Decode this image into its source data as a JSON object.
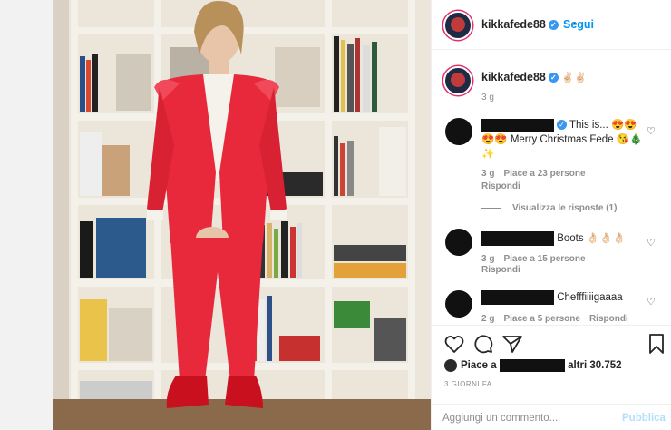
{
  "header": {
    "username": "kikkafede88",
    "follow_label": "Segui",
    "separator": "•"
  },
  "caption": {
    "username": "kikkafede88",
    "emoji": "✌🏻✌🏻",
    "time": "3 g"
  },
  "comments": [
    {
      "text_1": "This is... 😍😍",
      "text_2": "😍😍 Merry Christmas Fede 😘🎄",
      "text_3": "✨",
      "time": "3 g",
      "likes": "Piace a 23 persone",
      "reply_label": "Rispondi",
      "view_replies": "Visualizza le risposte (1)"
    },
    {
      "text": "Boots 👌🏻👌🏻👌🏻",
      "time": "3 g",
      "likes": "Piace a 15 persone",
      "reply_label": "Rispondi"
    },
    {
      "text": "Chefffiiiigaaaa",
      "time": "2 g",
      "likes": "Piace a 5 persone",
      "reply_label": "Rispondi"
    }
  ],
  "actions": {
    "likes_prefix": "Piace a",
    "likes_suffix": "altri 30.752",
    "time_ago": "3 GIORNI FA",
    "comment_placeholder": "Aggiungi un commento...",
    "publish_label": "Pubblica"
  },
  "colors": {
    "link_blue": "#0095f6",
    "verified_blue": "#3897f0",
    "suit_red": "#e8293c"
  },
  "icons": [
    "heart-icon",
    "comment-icon",
    "share-icon",
    "bookmark-icon",
    "verified-icon"
  ]
}
